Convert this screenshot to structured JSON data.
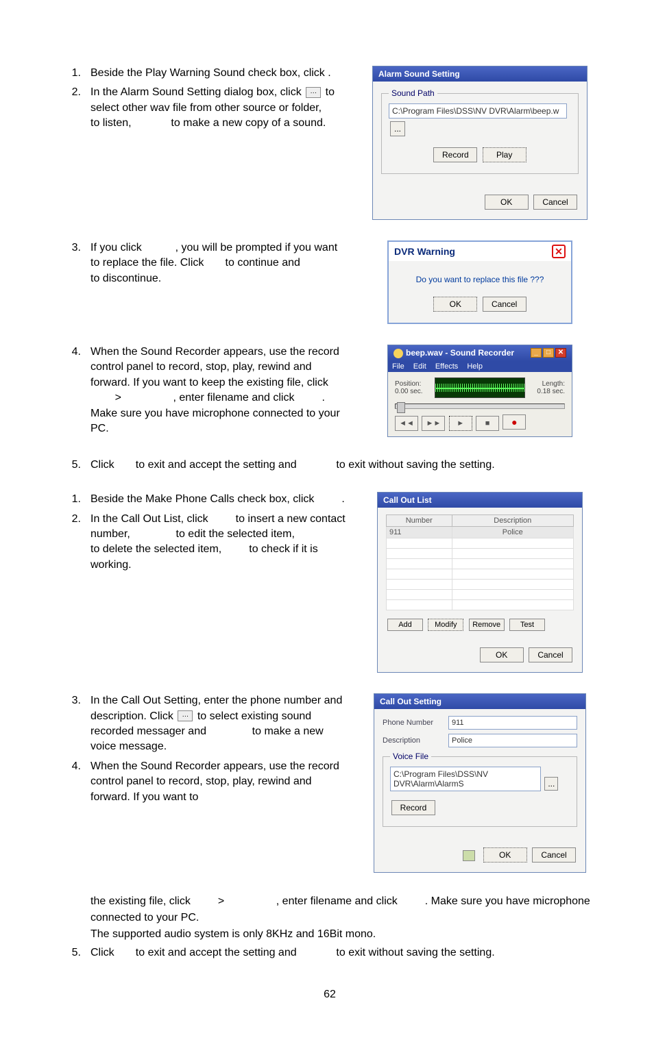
{
  "page_number": "62",
  "section_a": {
    "s1": {
      "text_a": "Beside the Play Warning Sound check box, click",
      "text_end": "."
    },
    "s2": {
      "text_a": "In the Alarm Sound Setting dialog box, click",
      "text_b": "to select other wav file from other source or folder,",
      "text_c": "to listen,",
      "text_d": "to make a new copy of a sound."
    },
    "s3": {
      "text_a": "If you click",
      "text_b": ", you will be prompted if you want to replace the file.    Click",
      "text_c": "to continue and",
      "text_d": "to discontinue."
    },
    "s4": {
      "text_a": "When the Sound Recorder appears, use the record control panel to record, stop, play, rewind and forward. If you want to keep the existing file, click",
      "text_b": ">",
      "text_c": ", enter filename and click",
      "text_d": ". Make sure you have microphone connected to your PC."
    },
    "s5": {
      "text_a": "Click",
      "text_b": "to exit and accept the setting and",
      "text_c": "to exit without saving the setting."
    }
  },
  "alarm_sound_setting": {
    "title": "Alarm Sound Setting",
    "fieldset_legend": "Sound Path",
    "path_value": "C:\\Program Files\\DSS\\NV DVR\\Alarm\\beep.w",
    "browse": "...",
    "record": "Record",
    "play": "Play",
    "ok": "OK",
    "cancel": "Cancel"
  },
  "dvr_warning": {
    "title": "DVR Warning",
    "message": "Do you want to replace this file ???",
    "ok": "OK",
    "cancel": "Cancel"
  },
  "sound_recorder": {
    "title": "beep.wav - Sound Recorder",
    "menu_file": "File",
    "menu_edit": "Edit",
    "menu_effects": "Effects",
    "menu_help": "Help",
    "position_label": "Position:",
    "position_value": "0.00 sec.",
    "length_label": "Length:",
    "length_value": "0.18 sec.",
    "btn_rew": "◄◄",
    "btn_ff": "►►",
    "btn_play": "►",
    "btn_stop": "■",
    "btn_rec": "●"
  },
  "section_b": {
    "s1": {
      "text_a": "Beside the Make Phone Calls check box, click",
      "text_end": "."
    },
    "s2": {
      "text_a": "In the Call Out List, click",
      "text_b": "to insert a new contact number,",
      "text_c": "to edit the selected item,",
      "text_d": "to delete the selected item,",
      "text_e": "to check if it is working."
    },
    "s3": {
      "text_a": "In the Call Out Setting, enter the phone number and description. Click",
      "text_b": "to select existing sound recorded messager and",
      "text_c": "to make a new voice message."
    },
    "s4": {
      "text_a": "When the Sound Recorder appears, use the record control panel to record, stop, play, rewind and forward. If you want to"
    },
    "tail_a": "the existing file, click",
    "tail_b": ">",
    "tail_c": ", enter filename and click",
    "tail_d": ". Make sure you have microphone connected to your PC.",
    "tail_e": "The supported audio system is only 8KHz and 16Bit mono.",
    "s5": {
      "text_a": "Click",
      "text_b": "to exit and accept the setting and",
      "text_c": "to exit without saving the setting."
    }
  },
  "call_out_list": {
    "title": "Call Out List",
    "col_number": "Number",
    "col_desc": "Description",
    "row_number": "911",
    "row_desc": "Police",
    "add": "Add",
    "modify": "Modify",
    "remove": "Remove",
    "test": "Test",
    "ok": "OK",
    "cancel": "Cancel"
  },
  "call_out_setting": {
    "title": "Call Out Setting",
    "phone_label": "Phone Number",
    "phone_value": "911",
    "desc_label": "Description",
    "desc_value": "Police",
    "voice_legend": "Voice File",
    "path_value": "C:\\Program Files\\DSS\\NV DVR\\Alarm\\AlarmS",
    "browse": "...",
    "record": "Record",
    "ok": "OK",
    "cancel": "Cancel"
  }
}
